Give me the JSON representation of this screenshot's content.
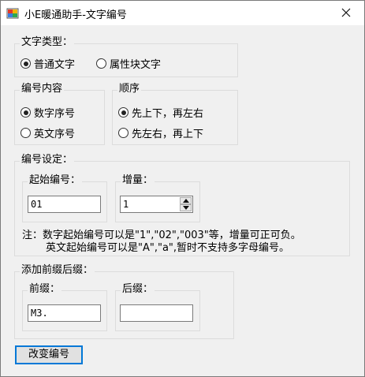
{
  "window": {
    "title": "小E暖通助手-文字编号",
    "icon": "app-icon",
    "close": "close-icon"
  },
  "text_type": {
    "legend": "文字类型：",
    "options": [
      {
        "label": "普通文字",
        "selected": true
      },
      {
        "label": "属性块文字",
        "selected": false
      }
    ]
  },
  "numbering_content": {
    "legend": "编号内容",
    "options": [
      {
        "label": "数字序号",
        "selected": true
      },
      {
        "label": "英文序号",
        "selected": false
      }
    ]
  },
  "order": {
    "legend": "顺序",
    "options": [
      {
        "label": "先上下，再左右",
        "selected": true
      },
      {
        "label": "先左右，再上下",
        "selected": false
      }
    ]
  },
  "numbering_settings": {
    "legend": "编号设定：",
    "start": {
      "legend": "起始编号：",
      "value": "01"
    },
    "increment": {
      "legend": "增量：",
      "value": "1"
    },
    "note_line1": "注：数字起始编号可以是\"1\",\"02\",\"003\"等，增量可正可负。",
    "note_line2": "英文起始编号可以是\"A\",\"a\",暂时不支持多字母编号。"
  },
  "affix": {
    "legend": "添加前缀后缀：",
    "prefix": {
      "legend": "前缀：",
      "value": "M3."
    },
    "suffix": {
      "legend": "后缀：",
      "value": ""
    }
  },
  "apply_button": "改变编号"
}
